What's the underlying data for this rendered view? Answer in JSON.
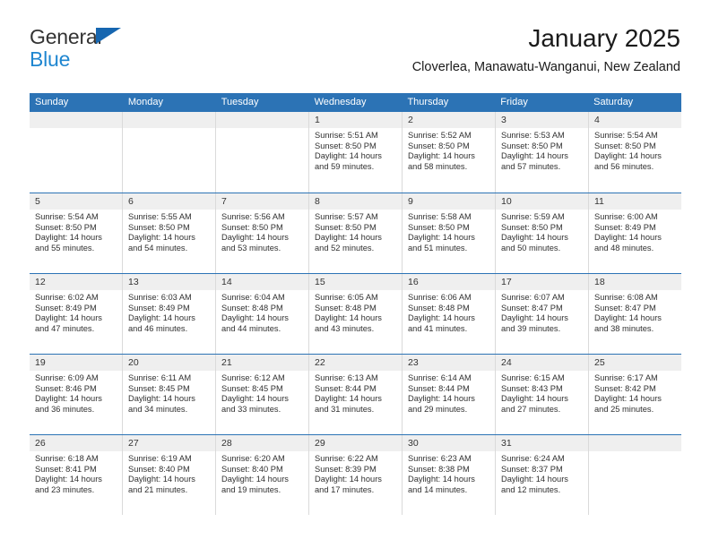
{
  "brand": {
    "line1": "General",
    "line2": "Blue",
    "triangle_color": "#1666b0",
    "blue_text_color": "#1f86d0"
  },
  "header": {
    "title": "January 2025",
    "subtitle": "Cloverlea, Manawatu-Wanganui, New Zealand"
  },
  "colors": {
    "header_blue": "#2c73b5",
    "day_band_gray": "#efefef",
    "cell_border": "#dadada",
    "text": "#303030"
  },
  "calendar": {
    "weekday_headers": [
      "Sunday",
      "Monday",
      "Tuesday",
      "Wednesday",
      "Thursday",
      "Friday",
      "Saturday"
    ],
    "weeks": [
      [
        {
          "day": "",
          "empty": true
        },
        {
          "day": "",
          "empty": true
        },
        {
          "day": "",
          "empty": true
        },
        {
          "day": "1",
          "sunrise": "Sunrise: 5:51 AM",
          "sunset": "Sunset: 8:50 PM",
          "daylight1": "Daylight: 14 hours",
          "daylight2": "and 59 minutes."
        },
        {
          "day": "2",
          "sunrise": "Sunrise: 5:52 AM",
          "sunset": "Sunset: 8:50 PM",
          "daylight1": "Daylight: 14 hours",
          "daylight2": "and 58 minutes."
        },
        {
          "day": "3",
          "sunrise": "Sunrise: 5:53 AM",
          "sunset": "Sunset: 8:50 PM",
          "daylight1": "Daylight: 14 hours",
          "daylight2": "and 57 minutes."
        },
        {
          "day": "4",
          "sunrise": "Sunrise: 5:54 AM",
          "sunset": "Sunset: 8:50 PM",
          "daylight1": "Daylight: 14 hours",
          "daylight2": "and 56 minutes."
        }
      ],
      [
        {
          "day": "5",
          "sunrise": "Sunrise: 5:54 AM",
          "sunset": "Sunset: 8:50 PM",
          "daylight1": "Daylight: 14 hours",
          "daylight2": "and 55 minutes."
        },
        {
          "day": "6",
          "sunrise": "Sunrise: 5:55 AM",
          "sunset": "Sunset: 8:50 PM",
          "daylight1": "Daylight: 14 hours",
          "daylight2": "and 54 minutes."
        },
        {
          "day": "7",
          "sunrise": "Sunrise: 5:56 AM",
          "sunset": "Sunset: 8:50 PM",
          "daylight1": "Daylight: 14 hours",
          "daylight2": "and 53 minutes."
        },
        {
          "day": "8",
          "sunrise": "Sunrise: 5:57 AM",
          "sunset": "Sunset: 8:50 PM",
          "daylight1": "Daylight: 14 hours",
          "daylight2": "and 52 minutes."
        },
        {
          "day": "9",
          "sunrise": "Sunrise: 5:58 AM",
          "sunset": "Sunset: 8:50 PM",
          "daylight1": "Daylight: 14 hours",
          "daylight2": "and 51 minutes."
        },
        {
          "day": "10",
          "sunrise": "Sunrise: 5:59 AM",
          "sunset": "Sunset: 8:50 PM",
          "daylight1": "Daylight: 14 hours",
          "daylight2": "and 50 minutes."
        },
        {
          "day": "11",
          "sunrise": "Sunrise: 6:00 AM",
          "sunset": "Sunset: 8:49 PM",
          "daylight1": "Daylight: 14 hours",
          "daylight2": "and 48 minutes."
        }
      ],
      [
        {
          "day": "12",
          "sunrise": "Sunrise: 6:02 AM",
          "sunset": "Sunset: 8:49 PM",
          "daylight1": "Daylight: 14 hours",
          "daylight2": "and 47 minutes."
        },
        {
          "day": "13",
          "sunrise": "Sunrise: 6:03 AM",
          "sunset": "Sunset: 8:49 PM",
          "daylight1": "Daylight: 14 hours",
          "daylight2": "and 46 minutes."
        },
        {
          "day": "14",
          "sunrise": "Sunrise: 6:04 AM",
          "sunset": "Sunset: 8:48 PM",
          "daylight1": "Daylight: 14 hours",
          "daylight2": "and 44 minutes."
        },
        {
          "day": "15",
          "sunrise": "Sunrise: 6:05 AM",
          "sunset": "Sunset: 8:48 PM",
          "daylight1": "Daylight: 14 hours",
          "daylight2": "and 43 minutes."
        },
        {
          "day": "16",
          "sunrise": "Sunrise: 6:06 AM",
          "sunset": "Sunset: 8:48 PM",
          "daylight1": "Daylight: 14 hours",
          "daylight2": "and 41 minutes."
        },
        {
          "day": "17",
          "sunrise": "Sunrise: 6:07 AM",
          "sunset": "Sunset: 8:47 PM",
          "daylight1": "Daylight: 14 hours",
          "daylight2": "and 39 minutes."
        },
        {
          "day": "18",
          "sunrise": "Sunrise: 6:08 AM",
          "sunset": "Sunset: 8:47 PM",
          "daylight1": "Daylight: 14 hours",
          "daylight2": "and 38 minutes."
        }
      ],
      [
        {
          "day": "19",
          "sunrise": "Sunrise: 6:09 AM",
          "sunset": "Sunset: 8:46 PM",
          "daylight1": "Daylight: 14 hours",
          "daylight2": "and 36 minutes."
        },
        {
          "day": "20",
          "sunrise": "Sunrise: 6:11 AM",
          "sunset": "Sunset: 8:45 PM",
          "daylight1": "Daylight: 14 hours",
          "daylight2": "and 34 minutes."
        },
        {
          "day": "21",
          "sunrise": "Sunrise: 6:12 AM",
          "sunset": "Sunset: 8:45 PM",
          "daylight1": "Daylight: 14 hours",
          "daylight2": "and 33 minutes."
        },
        {
          "day": "22",
          "sunrise": "Sunrise: 6:13 AM",
          "sunset": "Sunset: 8:44 PM",
          "daylight1": "Daylight: 14 hours",
          "daylight2": "and 31 minutes."
        },
        {
          "day": "23",
          "sunrise": "Sunrise: 6:14 AM",
          "sunset": "Sunset: 8:44 PM",
          "daylight1": "Daylight: 14 hours",
          "daylight2": "and 29 minutes."
        },
        {
          "day": "24",
          "sunrise": "Sunrise: 6:15 AM",
          "sunset": "Sunset: 8:43 PM",
          "daylight1": "Daylight: 14 hours",
          "daylight2": "and 27 minutes."
        },
        {
          "day": "25",
          "sunrise": "Sunrise: 6:17 AM",
          "sunset": "Sunset: 8:42 PM",
          "daylight1": "Daylight: 14 hours",
          "daylight2": "and 25 minutes."
        }
      ],
      [
        {
          "day": "26",
          "sunrise": "Sunrise: 6:18 AM",
          "sunset": "Sunset: 8:41 PM",
          "daylight1": "Daylight: 14 hours",
          "daylight2": "and 23 minutes."
        },
        {
          "day": "27",
          "sunrise": "Sunrise: 6:19 AM",
          "sunset": "Sunset: 8:40 PM",
          "daylight1": "Daylight: 14 hours",
          "daylight2": "and 21 minutes."
        },
        {
          "day": "28",
          "sunrise": "Sunrise: 6:20 AM",
          "sunset": "Sunset: 8:40 PM",
          "daylight1": "Daylight: 14 hours",
          "daylight2": "and 19 minutes."
        },
        {
          "day": "29",
          "sunrise": "Sunrise: 6:22 AM",
          "sunset": "Sunset: 8:39 PM",
          "daylight1": "Daylight: 14 hours",
          "daylight2": "and 17 minutes."
        },
        {
          "day": "30",
          "sunrise": "Sunrise: 6:23 AM",
          "sunset": "Sunset: 8:38 PM",
          "daylight1": "Daylight: 14 hours",
          "daylight2": "and 14 minutes."
        },
        {
          "day": "31",
          "sunrise": "Sunrise: 6:24 AM",
          "sunset": "Sunset: 8:37 PM",
          "daylight1": "Daylight: 14 hours",
          "daylight2": "and 12 minutes."
        },
        {
          "day": "",
          "empty": true
        }
      ]
    ]
  }
}
